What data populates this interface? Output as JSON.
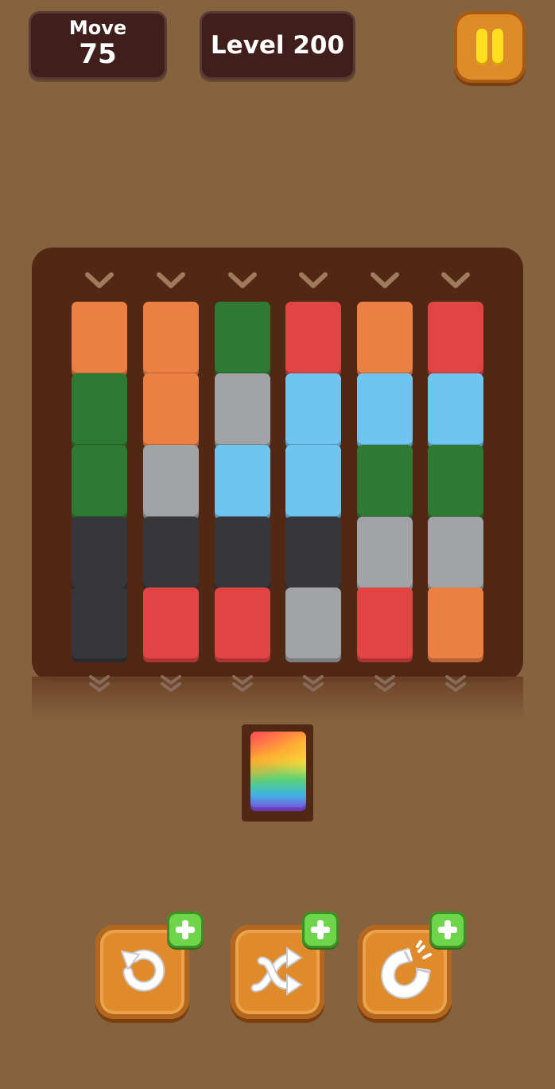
{
  "hud": {
    "move_label": "Move",
    "move_value": "75",
    "level_text": "Level 200"
  },
  "colors": {
    "orange": "#ec8044",
    "green": "#2f7a32",
    "red": "#e04543",
    "gray": "#a2a3a6",
    "blue": "#6ec5ef",
    "black": "#37363a"
  },
  "board": {
    "columns": [
      [
        "orange",
        "green",
        "green",
        "black",
        "black"
      ],
      [
        "orange",
        "orange",
        "gray",
        "black",
        "red"
      ],
      [
        "green",
        "gray",
        "blue",
        "black",
        "red"
      ],
      [
        "red",
        "blue",
        "blue",
        "black",
        "gray"
      ],
      [
        "orange",
        "blue",
        "green",
        "gray",
        "red"
      ],
      [
        "red",
        "blue",
        "green",
        "gray",
        "orange"
      ]
    ]
  },
  "held_tile": "rainbow",
  "tools": [
    {
      "name": "undo",
      "icon": "undo-icon"
    },
    {
      "name": "shuffle",
      "icon": "shuffle-icon"
    },
    {
      "name": "magnet",
      "icon": "magnet-icon"
    }
  ]
}
